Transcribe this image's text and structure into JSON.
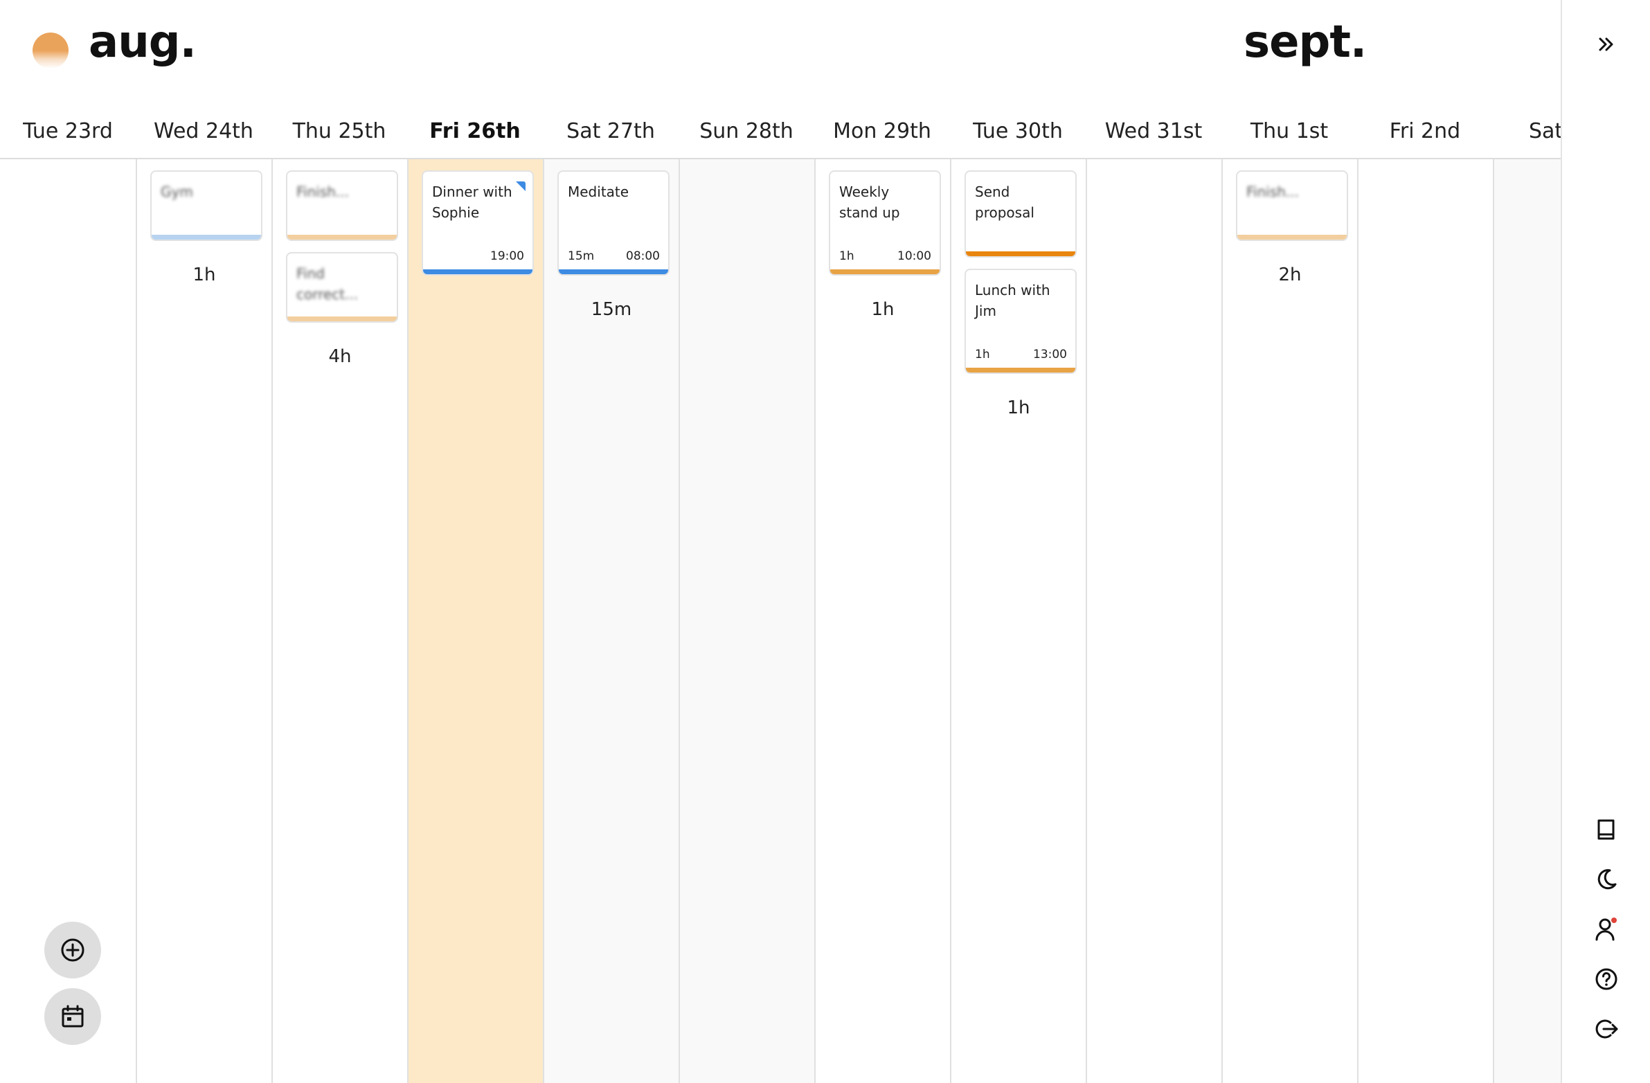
{
  "header": {
    "month_left": "aug.",
    "month_right": "sept."
  },
  "days": [
    {
      "label": "Tue 23rd",
      "state": "past",
      "events": [],
      "total": ""
    },
    {
      "label": "Wed 24th",
      "state": "past",
      "events": [
        {
          "title": "Gym",
          "blurred": true,
          "duration": "",
          "time": "",
          "bar_color": "#b7d3f0"
        }
      ],
      "total": "1h"
    },
    {
      "label": "Thu 25th",
      "state": "past",
      "events": [
        {
          "title": "Finish...",
          "blurred": true,
          "duration": "",
          "time": "",
          "bar_color": "#f3cf9f"
        },
        {
          "title": "Find correct...",
          "blurred": true,
          "duration": "",
          "time": "",
          "bar_color": "#f3cf9f"
        }
      ],
      "total": "4h"
    },
    {
      "label": "Fri 26th",
      "state": "today",
      "events": [
        {
          "title": "Dinner with Sophie",
          "blurred": false,
          "duration": "",
          "time": "19:00",
          "bar_color": "#3d8be3",
          "has_marker": true
        }
      ],
      "total": ""
    },
    {
      "label": "Sat 27th",
      "state": "weekend",
      "events": [
        {
          "title": "Meditate",
          "blurred": false,
          "duration": "15m",
          "time": "08:00",
          "bar_color": "#3d8be3"
        }
      ],
      "total": "15m"
    },
    {
      "label": "Sun 28th",
      "state": "weekend",
      "events": [],
      "total": ""
    },
    {
      "label": "Mon 29th",
      "state": "normal",
      "events": [
        {
          "title": "Weekly stand up",
          "blurred": false,
          "duration": "1h",
          "time": "10:00",
          "bar_color": "#e8a345"
        }
      ],
      "total": "1h"
    },
    {
      "label": "Tue 30th",
      "state": "normal",
      "events": [
        {
          "title": "Send proposal",
          "blurred": false,
          "duration": "",
          "time": "",
          "bar_color": "#e8850f"
        },
        {
          "title": "Lunch with Jim",
          "blurred": false,
          "duration": "1h",
          "time": "13:00",
          "bar_color": "#e8a345"
        }
      ],
      "total": "1h"
    },
    {
      "label": "Wed 31st",
      "state": "normal",
      "events": [],
      "total": ""
    },
    {
      "label": "Thu 1st",
      "state": "normal",
      "events": [
        {
          "title": "Finish...",
          "blurred": true,
          "duration": "",
          "time": "",
          "bar_color": "#f3cf9f"
        }
      ],
      "total": "2h"
    },
    {
      "label": "Fri 2nd",
      "state": "normal",
      "events": [],
      "total": ""
    },
    {
      "label": "Sat",
      "state": "weekend",
      "events": [],
      "total": ""
    }
  ],
  "colors": {
    "accent": "#eaa35a",
    "today_bg": "#fde9c8",
    "weekend_bg": "#f9f9f9",
    "notification_dot": "#e0443a"
  },
  "fab": {
    "add_icon": "plus-circle-icon",
    "calendar_icon": "calendar-icon"
  },
  "sidebar": {
    "expand_icon": "double-chevron-right-icon",
    "icons": [
      "book-icon",
      "moon-icon",
      "user-icon",
      "help-icon",
      "logout-icon"
    ]
  }
}
